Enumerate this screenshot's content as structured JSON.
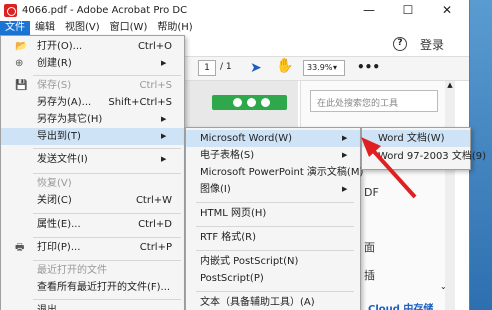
{
  "window": {
    "title": "4066.pdf - Adobe Acrobat Pro DC"
  },
  "menubar": [
    {
      "label": "文件"
    },
    {
      "label": "编辑"
    },
    {
      "label": "视图(V)"
    },
    {
      "label": "窗口(W)"
    },
    {
      "label": "帮助(H)"
    }
  ],
  "toolbar": {
    "login_label": "登录",
    "page_value": "1",
    "page_total": "/ 1",
    "zoom_value": "33.9%",
    "more": "•••"
  },
  "side_panel": {
    "search_placeholder": "在此处搜索您的工具",
    "partial_1": "DF",
    "partial_2": "面",
    "partial_3": "插",
    "cloud_text": "Cloud 中存储"
  },
  "file_menu": [
    {
      "label": "打开(O)...",
      "shortcut": "Ctrl+O",
      "icon": "folder-open-icon",
      "glyph": "📂"
    },
    {
      "label": "创建(R)",
      "icon": "create-icon",
      "glyph": "⊕"
    },
    {
      "label": "保存(S)",
      "shortcut": "Ctrl+S",
      "disabled": true,
      "icon": "save-icon",
      "glyph": "💾"
    },
    {
      "label": "另存为(A)...",
      "shortcut": "Shift+Ctrl+S"
    },
    {
      "label": "另存为其它(H)"
    },
    {
      "label": "导出到(T)"
    },
    {
      "label": "发送文件(I)"
    },
    {
      "label": "恢复(V)",
      "disabled": true
    },
    {
      "label": "关闭(C)",
      "shortcut": "Ctrl+W"
    },
    {
      "label": "属性(E)...",
      "shortcut": "Ctrl+D"
    },
    {
      "label": "打印(P)...",
      "shortcut": "Ctrl+P",
      "icon": "print-icon",
      "glyph": "🖶"
    },
    {
      "label": "最近打开的文件",
      "disabled": true
    },
    {
      "label": "查看所有最近打开的文件(F)..."
    },
    {
      "label": "退出..."
    }
  ],
  "export_submenu": [
    {
      "label": "Microsoft Word(W)"
    },
    {
      "label": "电子表格(S)"
    },
    {
      "label": "Microsoft PowerPoint 演示文稿(M)"
    },
    {
      "label": "图像(I)"
    },
    {
      "label": "HTML 网页(H)"
    },
    {
      "label": "RTF 格式(R)"
    },
    {
      "label": "内嵌式 PostScript(N)"
    },
    {
      "label": "PostScript(P)"
    },
    {
      "label": "文本（具备辅助工具）(A)"
    }
  ],
  "word_submenu": [
    {
      "label": "Word 文档(W)"
    },
    {
      "label": "Word 97-2003 文档(9)"
    }
  ],
  "colors": {
    "accent": "#1b73d3",
    "annotation_arrow": "#e02020"
  }
}
